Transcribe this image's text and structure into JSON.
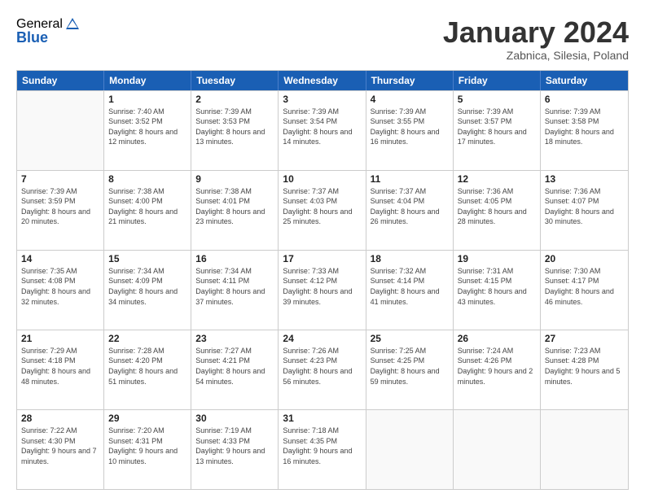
{
  "header": {
    "logo_general": "General",
    "logo_blue": "Blue",
    "month_title": "January 2024",
    "location": "Zabnica, Silesia, Poland"
  },
  "weekdays": [
    "Sunday",
    "Monday",
    "Tuesday",
    "Wednesday",
    "Thursday",
    "Friday",
    "Saturday"
  ],
  "rows": [
    [
      {
        "day": "",
        "sunrise": "",
        "sunset": "",
        "daylight": ""
      },
      {
        "day": "1",
        "sunrise": "Sunrise: 7:40 AM",
        "sunset": "Sunset: 3:52 PM",
        "daylight": "Daylight: 8 hours and 12 minutes."
      },
      {
        "day": "2",
        "sunrise": "Sunrise: 7:39 AM",
        "sunset": "Sunset: 3:53 PM",
        "daylight": "Daylight: 8 hours and 13 minutes."
      },
      {
        "day": "3",
        "sunrise": "Sunrise: 7:39 AM",
        "sunset": "Sunset: 3:54 PM",
        "daylight": "Daylight: 8 hours and 14 minutes."
      },
      {
        "day": "4",
        "sunrise": "Sunrise: 7:39 AM",
        "sunset": "Sunset: 3:55 PM",
        "daylight": "Daylight: 8 hours and 16 minutes."
      },
      {
        "day": "5",
        "sunrise": "Sunrise: 7:39 AM",
        "sunset": "Sunset: 3:57 PM",
        "daylight": "Daylight: 8 hours and 17 minutes."
      },
      {
        "day": "6",
        "sunrise": "Sunrise: 7:39 AM",
        "sunset": "Sunset: 3:58 PM",
        "daylight": "Daylight: 8 hours and 18 minutes."
      }
    ],
    [
      {
        "day": "7",
        "sunrise": "Sunrise: 7:39 AM",
        "sunset": "Sunset: 3:59 PM",
        "daylight": "Daylight: 8 hours and 20 minutes."
      },
      {
        "day": "8",
        "sunrise": "Sunrise: 7:38 AM",
        "sunset": "Sunset: 4:00 PM",
        "daylight": "Daylight: 8 hours and 21 minutes."
      },
      {
        "day": "9",
        "sunrise": "Sunrise: 7:38 AM",
        "sunset": "Sunset: 4:01 PM",
        "daylight": "Daylight: 8 hours and 23 minutes."
      },
      {
        "day": "10",
        "sunrise": "Sunrise: 7:37 AM",
        "sunset": "Sunset: 4:03 PM",
        "daylight": "Daylight: 8 hours and 25 minutes."
      },
      {
        "day": "11",
        "sunrise": "Sunrise: 7:37 AM",
        "sunset": "Sunset: 4:04 PM",
        "daylight": "Daylight: 8 hours and 26 minutes."
      },
      {
        "day": "12",
        "sunrise": "Sunrise: 7:36 AM",
        "sunset": "Sunset: 4:05 PM",
        "daylight": "Daylight: 8 hours and 28 minutes."
      },
      {
        "day": "13",
        "sunrise": "Sunrise: 7:36 AM",
        "sunset": "Sunset: 4:07 PM",
        "daylight": "Daylight: 8 hours and 30 minutes."
      }
    ],
    [
      {
        "day": "14",
        "sunrise": "Sunrise: 7:35 AM",
        "sunset": "Sunset: 4:08 PM",
        "daylight": "Daylight: 8 hours and 32 minutes."
      },
      {
        "day": "15",
        "sunrise": "Sunrise: 7:34 AM",
        "sunset": "Sunset: 4:09 PM",
        "daylight": "Daylight: 8 hours and 34 minutes."
      },
      {
        "day": "16",
        "sunrise": "Sunrise: 7:34 AM",
        "sunset": "Sunset: 4:11 PM",
        "daylight": "Daylight: 8 hours and 37 minutes."
      },
      {
        "day": "17",
        "sunrise": "Sunrise: 7:33 AM",
        "sunset": "Sunset: 4:12 PM",
        "daylight": "Daylight: 8 hours and 39 minutes."
      },
      {
        "day": "18",
        "sunrise": "Sunrise: 7:32 AM",
        "sunset": "Sunset: 4:14 PM",
        "daylight": "Daylight: 8 hours and 41 minutes."
      },
      {
        "day": "19",
        "sunrise": "Sunrise: 7:31 AM",
        "sunset": "Sunset: 4:15 PM",
        "daylight": "Daylight: 8 hours and 43 minutes."
      },
      {
        "day": "20",
        "sunrise": "Sunrise: 7:30 AM",
        "sunset": "Sunset: 4:17 PM",
        "daylight": "Daylight: 8 hours and 46 minutes."
      }
    ],
    [
      {
        "day": "21",
        "sunrise": "Sunrise: 7:29 AM",
        "sunset": "Sunset: 4:18 PM",
        "daylight": "Daylight: 8 hours and 48 minutes."
      },
      {
        "day": "22",
        "sunrise": "Sunrise: 7:28 AM",
        "sunset": "Sunset: 4:20 PM",
        "daylight": "Daylight: 8 hours and 51 minutes."
      },
      {
        "day": "23",
        "sunrise": "Sunrise: 7:27 AM",
        "sunset": "Sunset: 4:21 PM",
        "daylight": "Daylight: 8 hours and 54 minutes."
      },
      {
        "day": "24",
        "sunrise": "Sunrise: 7:26 AM",
        "sunset": "Sunset: 4:23 PM",
        "daylight": "Daylight: 8 hours and 56 minutes."
      },
      {
        "day": "25",
        "sunrise": "Sunrise: 7:25 AM",
        "sunset": "Sunset: 4:25 PM",
        "daylight": "Daylight: 8 hours and 59 minutes."
      },
      {
        "day": "26",
        "sunrise": "Sunrise: 7:24 AM",
        "sunset": "Sunset: 4:26 PM",
        "daylight": "Daylight: 9 hours and 2 minutes."
      },
      {
        "day": "27",
        "sunrise": "Sunrise: 7:23 AM",
        "sunset": "Sunset: 4:28 PM",
        "daylight": "Daylight: 9 hours and 5 minutes."
      }
    ],
    [
      {
        "day": "28",
        "sunrise": "Sunrise: 7:22 AM",
        "sunset": "Sunset: 4:30 PM",
        "daylight": "Daylight: 9 hours and 7 minutes."
      },
      {
        "day": "29",
        "sunrise": "Sunrise: 7:20 AM",
        "sunset": "Sunset: 4:31 PM",
        "daylight": "Daylight: 9 hours and 10 minutes."
      },
      {
        "day": "30",
        "sunrise": "Sunrise: 7:19 AM",
        "sunset": "Sunset: 4:33 PM",
        "daylight": "Daylight: 9 hours and 13 minutes."
      },
      {
        "day": "31",
        "sunrise": "Sunrise: 7:18 AM",
        "sunset": "Sunset: 4:35 PM",
        "daylight": "Daylight: 9 hours and 16 minutes."
      },
      {
        "day": "",
        "sunrise": "",
        "sunset": "",
        "daylight": ""
      },
      {
        "day": "",
        "sunrise": "",
        "sunset": "",
        "daylight": ""
      },
      {
        "day": "",
        "sunrise": "",
        "sunset": "",
        "daylight": ""
      }
    ]
  ]
}
